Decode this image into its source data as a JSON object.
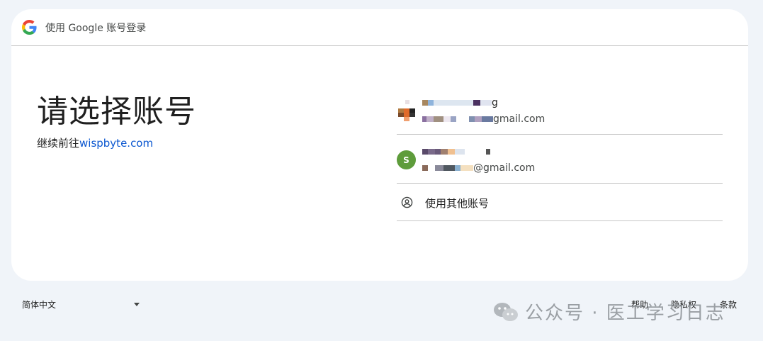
{
  "header": {
    "title": "使用 Google 账号登录"
  },
  "main": {
    "headline": "请选择账号",
    "continue_prefix": "继续前往",
    "continue_site": "wispbyte.com"
  },
  "accounts": [
    {
      "name_suffix": "g",
      "email_suffix": "gmail.com"
    },
    {
      "avatar_letter": "S",
      "email_suffix": "@gmail.com",
      "avatar_color": "#5e9c3b"
    }
  ],
  "other_account": {
    "label": "使用其他账号"
  },
  "footer": {
    "language": "简体中文",
    "links": {
      "help": "帮助",
      "privacy": "隐私权",
      "terms": "条款"
    }
  },
  "watermark": {
    "text": "公众号 · 医工学习日志"
  },
  "colors": {
    "link": "#0b57d0",
    "background": "#f0f4f9",
    "card": "#ffffff",
    "divider": "#c7c7c7"
  }
}
